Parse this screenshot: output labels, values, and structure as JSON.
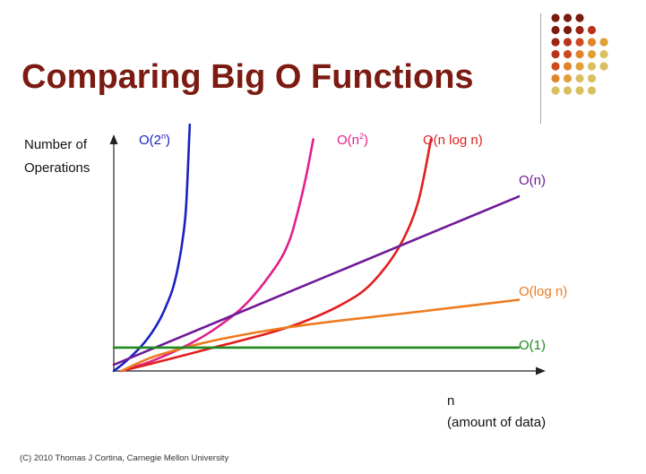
{
  "slide": {
    "title": "Comparing Big O Functions",
    "footer": "(C) 2010 Thomas J Cortina, Carnegie Mellon University"
  },
  "decoration": {
    "dot_rows": [
      [
        "#7b1b12",
        "#7b1b12",
        "#7b1b12"
      ],
      [
        "#7b1b12",
        "#7b1b12",
        "#9c2412",
        "#b8331a"
      ],
      [
        "#9c2412",
        "#b8331a",
        "#cc4a1c",
        "#e0842a",
        "#e0a035"
      ],
      [
        "#b8331a",
        "#cc4a1c",
        "#e0842a",
        "#e0a035",
        "#d8c060"
      ],
      [
        "#cc4a1c",
        "#e0842a",
        "#e0a035",
        "#d8c060",
        "#d8c060"
      ],
      [
        "#e0842a",
        "#e0a035",
        "#d8c060",
        "#d8c060"
      ],
      [
        "#d8c060",
        "#d8c060",
        "#d8c060",
        "#d8c060"
      ]
    ]
  },
  "chart_data": {
    "type": "line",
    "title": "",
    "ylabel": "Number of Operations",
    "ylabel_lines": [
      "Number of",
      "Operations"
    ],
    "xlabel": "n (amount of data)",
    "xlabel_lines": [
      "n",
      "(amount of data)"
    ],
    "xlim": [
      0,
      10
    ],
    "ylim": [
      0,
      10
    ],
    "grid": false,
    "legend": "inline labels at line ends",
    "series": [
      {
        "key": "o2n",
        "label_base": "O(2",
        "label_sup": "n",
        "label_end": ")",
        "color": "#1a22c0",
        "x": [
          0.0,
          0.5,
          1.0,
          1.5,
          2.0,
          2.5,
          3.0,
          3.2,
          3.4,
          3.6,
          3.8,
          4.0
        ],
        "y": [
          0.0,
          0.3,
          0.65,
          1.05,
          1.55,
          2.2,
          3.1,
          3.6,
          4.3,
          5.2,
          6.6,
          10.0
        ]
      },
      {
        "key": "on2",
        "label_base": "O(n",
        "label_sup": "2",
        "label_end": ")",
        "color": "#e0208a",
        "x": [
          0.4,
          2.0,
          4.0,
          5.5,
          7.0,
          8.5,
          9.2,
          9.6,
          10.1,
          10.5
        ],
        "y": [
          0.0,
          0.4,
          1.1,
          1.8,
          2.75,
          4.2,
          5.2,
          6.2,
          7.8,
          9.4
        ]
      },
      {
        "key": "onlogn",
        "label_base": "O(n log n)",
        "label_sup": "",
        "label_end": "",
        "color": "#e21e1e",
        "x": [
          0.4,
          2.0,
          5.0,
          8.0,
          10.0,
          12.0,
          13.5,
          15.0,
          16.0,
          16.7
        ],
        "y": [
          0.0,
          0.3,
          0.9,
          1.5,
          2.0,
          2.7,
          3.5,
          5.0,
          6.8,
          9.4
        ]
      },
      {
        "key": "on",
        "label_base": "O(n)",
        "label_sup": "",
        "label_end": "",
        "color": "#6e1a98",
        "x": [
          0.0,
          22.0
        ],
        "y": [
          0.25,
          7.3
        ]
      },
      {
        "key": "ologn",
        "label_base": "O(log n)",
        "label_sup": "",
        "label_end": "",
        "color": "#ee7a1e",
        "x": [
          0.4,
          2.0,
          4.0,
          6.0,
          9.0,
          12.0,
          16.0,
          22.0
        ],
        "y": [
          0.0,
          0.55,
          1.0,
          1.35,
          1.75,
          2.05,
          2.4,
          2.95
        ]
      },
      {
        "key": "o1",
        "label_base": "O(1)",
        "label_sup": "",
        "label_end": "",
        "color": "#1f8a1f",
        "x": [
          0.0,
          22.0
        ],
        "y": [
          0.95,
          0.95
        ]
      }
    ]
  }
}
